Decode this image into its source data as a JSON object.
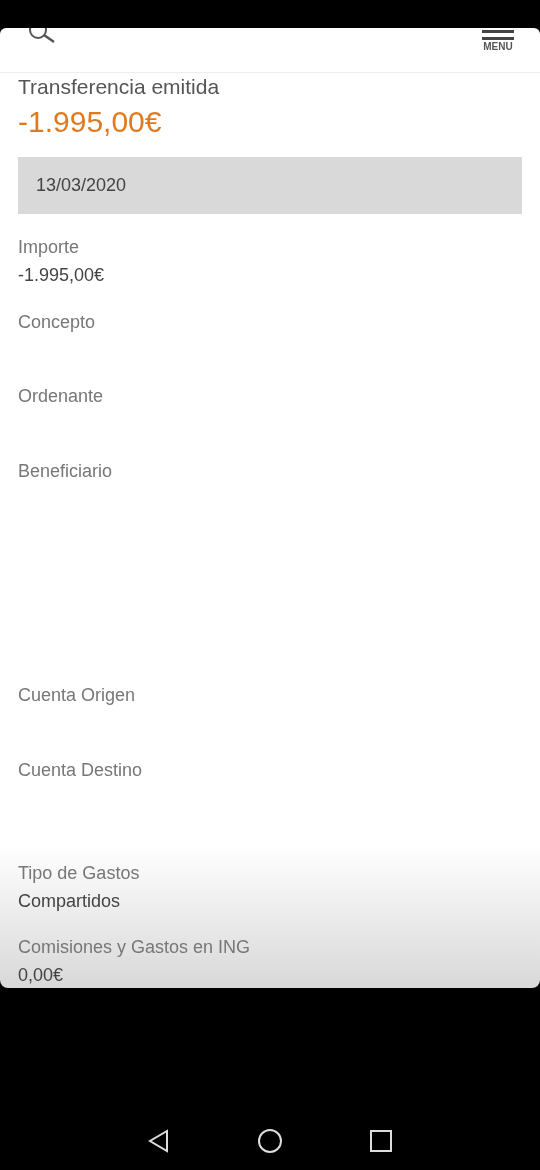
{
  "header": {
    "menu_label": "MENU"
  },
  "title": "Transferencia emitida",
  "amount": "-1.995,00€",
  "date": "13/03/2020",
  "fields": [
    {
      "label": "Importe",
      "value": "-1.995,00€"
    },
    {
      "label": "Concepto"
    },
    {
      "label": "Ordenante"
    },
    {
      "label": "Beneficiario"
    },
    {
      "label": "Cuenta Origen"
    },
    {
      "label": "Cuenta Destino"
    },
    {
      "label": "Tipo de Gastos",
      "value": "Compartidos"
    },
    {
      "label": "Comisiones y Gastos en ING",
      "value": "0,00€"
    }
  ]
}
